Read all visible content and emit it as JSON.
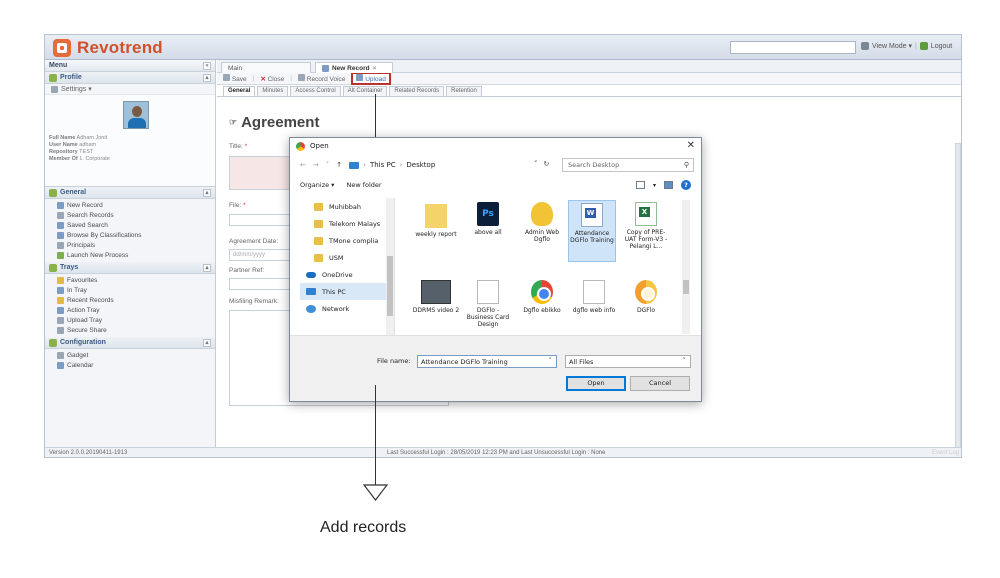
{
  "header": {
    "logo_text": "Revotrend",
    "view_mode": "View Mode ▾",
    "logout": "Logout"
  },
  "sidebar": {
    "title": "Menu",
    "profile_section": "Profile",
    "settings": "Settings ▾",
    "profile": {
      "full_name_label": "Full Name",
      "full_name": "Adham Jonit",
      "user_name_label": "User Name",
      "user_name": "adham",
      "repository_label": "Repository",
      "repository": "TEST",
      "member_of_label": "Member Of",
      "member_of": "1. Corporate"
    },
    "general": {
      "title": "General",
      "items": [
        "New Record",
        "Search Records",
        "Saved Search",
        "Browse By Classifications",
        "Principals",
        "Launch New Process"
      ]
    },
    "trays": {
      "title": "Trays",
      "items": [
        "Favourites",
        "In Tray",
        "Recent Records",
        "Action Tray",
        "Upload Tray",
        "Secure Share"
      ]
    },
    "configuration": {
      "title": "Configuration",
      "items": [
        "Gadget",
        "Calendar"
      ]
    }
  },
  "main": {
    "tabs": [
      "Main",
      "New Record"
    ],
    "toolbar": {
      "save": "Save",
      "close": "Close",
      "record_voice": "Record Voice",
      "upload": "Upload"
    },
    "sub_tabs": [
      "General",
      "Minutes",
      "Access Control",
      "Alt Container",
      "Related Records",
      "Retention"
    ],
    "form": {
      "title": "Agreement",
      "title_label": "Title:",
      "file_label": "File:",
      "agreement_date_label": "Agreement Date:",
      "date_placeholder": "dd/mm/yyyy",
      "partner_ref_label": "Partner Ref:",
      "misfiling_label": "Misfiling Remark:"
    }
  },
  "status_bar": {
    "version": "Version 2.0.0.20190411-1913",
    "login_info": "Last Successful Login : 28/05/2019 12:23 PM and Last Unsuccessful Login : None",
    "right": "Event Log"
  },
  "dialog": {
    "title": "Open",
    "path": [
      "This PC",
      "Desktop"
    ],
    "search_placeholder": "Search Desktop",
    "organize": "Organize ▾",
    "new_folder": "New folder",
    "nav_items": [
      {
        "label": "Muhibbah",
        "icon": "folder-icon"
      },
      {
        "label": "Telekom Malays",
        "icon": "folder-icon"
      },
      {
        "label": "TMone complia",
        "icon": "folder-icon"
      },
      {
        "label": "USM",
        "icon": "folder-icon"
      },
      {
        "label": "OneDrive",
        "icon": "onedrive-icon"
      },
      {
        "label": "This PC",
        "icon": "computer-icon"
      },
      {
        "label": "Network",
        "icon": "network-icon"
      }
    ],
    "files": [
      {
        "name": "weekly report",
        "icon": "folder-image-icon"
      },
      {
        "name": "above all",
        "icon": "photoshop-icon"
      },
      {
        "name": "Admin Web Dgflo",
        "icon": "shield-icon"
      },
      {
        "name": "Attendance DGFlo Training",
        "icon": "word-icon"
      },
      {
        "name": "Copy of PRE-UAT Form-V3 - Pelangi L...",
        "icon": "excel-icon"
      },
      {
        "name": "DDRMS video 2",
        "icon": "video-icon"
      },
      {
        "name": "DGFlo - Business Card Design",
        "icon": "document-icon"
      },
      {
        "name": "Dgflo ebikko",
        "icon": "chrome-icon"
      },
      {
        "name": "dgflo web info",
        "icon": "text-document-icon"
      },
      {
        "name": "DGFlo",
        "icon": "chrome-canary-icon"
      }
    ],
    "file_name_label": "File name:",
    "file_name_value": "Attendance DGFlo Training",
    "file_type": "All Files",
    "open_button": "Open",
    "cancel_button": "Cancel"
  },
  "annotation": {
    "caption": "Add records"
  }
}
